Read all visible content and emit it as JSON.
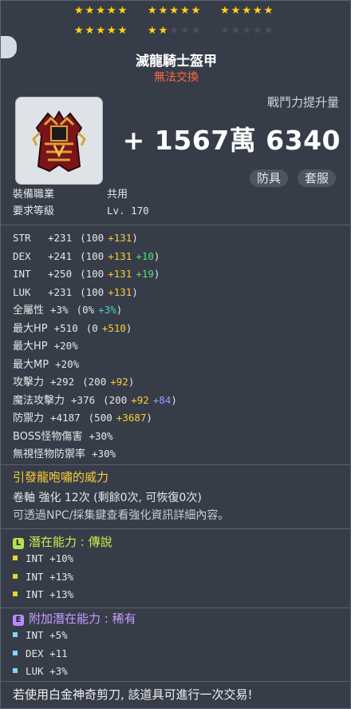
{
  "stars": {
    "row1": [
      "on",
      "on",
      "on",
      "on",
      "on",
      "on",
      "on",
      "on",
      "on",
      "on",
      "on",
      "on",
      "on",
      "on",
      "on"
    ],
    "row2": [
      "on",
      "on",
      "on",
      "on",
      "on",
      "on",
      "on",
      "off",
      "off",
      "off",
      "off",
      "off",
      "off",
      "off",
      "off"
    ]
  },
  "star_glyph": "★",
  "item": {
    "name": "滅龍騎士盔甲",
    "trade": "無法交換"
  },
  "combat": {
    "label": "戰鬥力提升量",
    "value": "+ 1567萬 6340"
  },
  "tags": [
    "防具",
    "套服"
  ],
  "req": [
    {
      "label": "裝備職業",
      "value": "共用"
    },
    {
      "label": "要求等級",
      "value": "Lv. 170"
    }
  ],
  "stats": [
    {
      "label": "STR",
      "total": "+231",
      "base": "(100",
      "bonus": "+131",
      "extra": "",
      "extra_color": "",
      "close": ")"
    },
    {
      "label": "DEX",
      "total": "+241",
      "base": "(100",
      "bonus": "+131",
      "extra": "+10",
      "extra_color": "green",
      "close": ")"
    },
    {
      "label": "INT",
      "total": "+250",
      "base": "(100",
      "bonus": "+131",
      "extra": "+19",
      "extra_color": "green",
      "close": ")"
    },
    {
      "label": "LUK",
      "total": "+231",
      "base": "(100",
      "bonus": "+131",
      "extra": "",
      "extra_color": "",
      "close": ")"
    },
    {
      "label": "全屬性",
      "total": "+3%",
      "base": "(0%",
      "bonus": "+3%",
      "extra": "",
      "extra_color": "",
      "close": ")",
      "bonus_color": "teal"
    },
    {
      "label": "最大HP",
      "total": "+510",
      "base": "(0",
      "bonus": "+510",
      "extra": "",
      "extra_color": "",
      "close": ")"
    },
    {
      "label": "最大HP",
      "total": "+20%",
      "base": "",
      "bonus": "",
      "extra": "",
      "extra_color": "",
      "close": ""
    },
    {
      "label": "最大MP",
      "total": "+20%",
      "base": "",
      "bonus": "",
      "extra": "",
      "extra_color": "",
      "close": ""
    },
    {
      "label": "攻擊力",
      "total": "+292",
      "base": "(200",
      "bonus": "+92",
      "extra": "",
      "extra_color": "",
      "close": ")"
    },
    {
      "label": "魔法攻擊力",
      "total": "+376",
      "base": "(200",
      "bonus": "+92",
      "extra": "+84",
      "extra_color": "violet",
      "close": ")"
    },
    {
      "label": "防禦力",
      "total": "+4187",
      "base": "(500",
      "bonus": "+3687",
      "extra": "",
      "extra_color": "",
      "close": ")"
    },
    {
      "label": "BOSS怪物傷害",
      "total": "+30%",
      "base": "",
      "bonus": "",
      "extra": "",
      "extra_color": "",
      "close": ""
    },
    {
      "label": "無視怪物防禦率",
      "total": "+30%",
      "base": "",
      "bonus": "",
      "extra": "",
      "extra_color": "",
      "close": ""
    }
  ],
  "soul": {
    "title": "引發龍咆嘯的威力"
  },
  "upgrade": {
    "line": "卷軸 強化 12次 (剩餘0次, 可恢復0次)",
    "note": "可透過NPC/採集鍵查看強化資訊詳細內容。"
  },
  "potential": {
    "badge": "L",
    "badge_color": "#b9e04a",
    "title_color": "#c9ef4e",
    "title": "潛在能力 : 傳說",
    "bullet_color": "#e8d530",
    "lines": [
      "INT +10%",
      "INT +13%",
      "INT +13%"
    ]
  },
  "bonus_potential": {
    "badge": "E",
    "badge_color": "#b58cff",
    "title_color": "#c79cff",
    "title": "附加潛在能力 : 稀有",
    "bullet_color": "#7fd7ff",
    "lines": [
      "INT +5%",
      "DEX +11",
      "LUK +3%"
    ]
  },
  "footer": "若使用白金神奇剪刀, 該道具可進行一次交易!"
}
